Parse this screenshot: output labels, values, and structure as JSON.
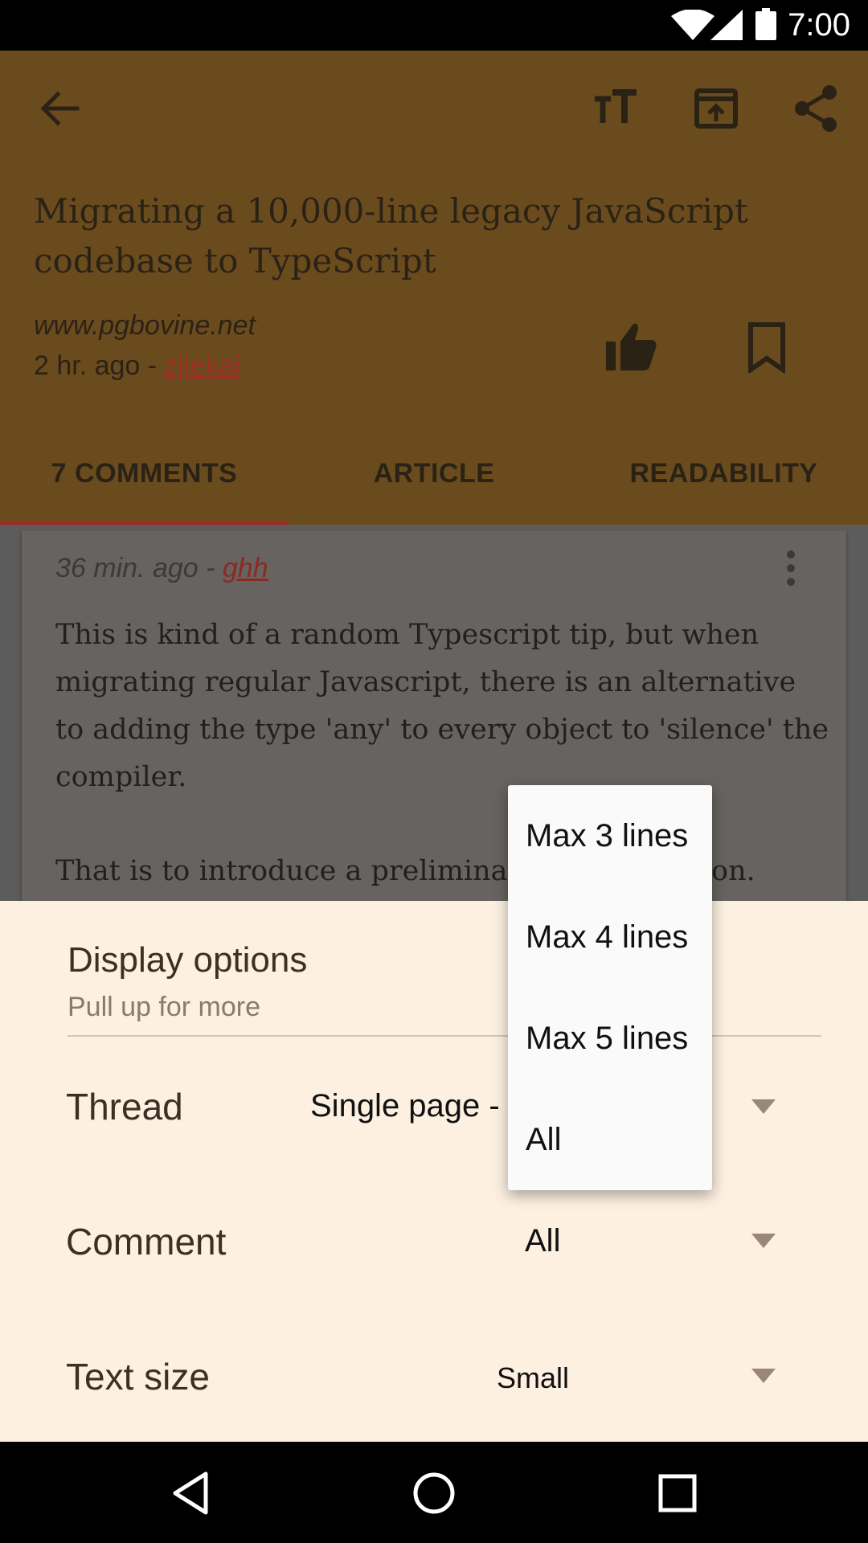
{
  "status_bar": {
    "time": "7:00",
    "icons": [
      "wifi-icon",
      "signal-icon",
      "battery-icon"
    ]
  },
  "app_bar": {
    "title": "Migrating a 10,000-line legacy JavaScript codebase to TypeScript",
    "site": "www.pgbovine.net",
    "age": "2 hr. ago - ",
    "author": "zjiekai",
    "actions": [
      "back-icon",
      "text-size-icon",
      "open-external-icon",
      "share-icon",
      "thumb-up-icon",
      "bookmark-icon"
    ]
  },
  "tabs": [
    {
      "label": "7 COMMENTS",
      "selected": true
    },
    {
      "label": "ARTICLE",
      "selected": false
    },
    {
      "label": "READABILITY",
      "selected": false
    }
  ],
  "comment": {
    "age": "36 min. ago - ",
    "author": "ghh",
    "lines": [
      "This is kind of a random Typescript tip, but when",
      "migrating regular Javascript, there is an alternative",
      "to adding the type 'any' to every object to 'silence' the",
      "compiler.",
      "",
      "That is to introduce a preliminar",
      "on."
    ]
  },
  "display_options": {
    "title": "Display options",
    "subtitle": "Pull up for more",
    "options": [
      {
        "label": "Thread",
        "value": "Single page -"
      },
      {
        "label": "Comment",
        "value": "All"
      },
      {
        "label": "Text size",
        "value": "Small"
      }
    ]
  },
  "popup": {
    "items": [
      "Max 3 lines",
      "Max 4 lines",
      "Max 5 lines",
      "All"
    ]
  },
  "colors": {
    "app_bar": "#6a4b1e",
    "accent": "#9b2e24",
    "sheet": "#fdf0e1"
  }
}
